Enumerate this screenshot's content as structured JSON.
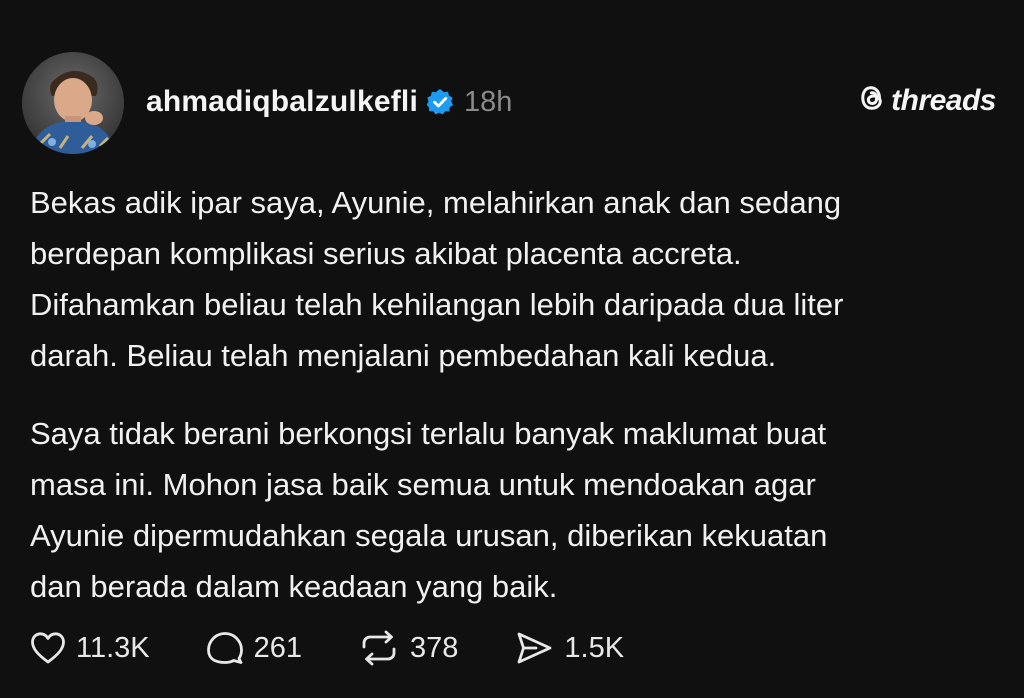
{
  "post": {
    "author": {
      "username": "ahmadiqbalzulkefli",
      "verified": true
    },
    "time": "18h",
    "brand": "threads",
    "paragraphs": [
      "Bekas adik ipar saya, Ayunie, melahirkan anak dan sedang\nberdepan komplikasi serius akibat placenta accreta.\nDifahamkan beliau telah kehilangan lebih daripada dua liter\ndarah. Beliau telah menjalani pembedahan kali kedua.",
      "Saya tidak berani berkongsi terlalu banyak maklumat buat\nmasa ini. Mohon jasa baik semua untuk mendoakan agar\nAyunie dipermudahkan segala urusan, diberikan kekuatan\ndan berada dalam keadaan yang baik."
    ],
    "stats": {
      "likes": "11.3K",
      "replies": "261",
      "reposts": "378",
      "shares": "1.5K"
    }
  },
  "colors": {
    "background": "#101010",
    "text": "#f1f1f1",
    "muted": "#8a8a8a",
    "verified": "#1d9bf0"
  },
  "icons": {
    "verified": "verified-badge-icon",
    "brand": "threads-logo-icon",
    "like": "heart-icon",
    "reply": "comment-icon",
    "repost": "repost-icon",
    "share": "send-icon"
  }
}
